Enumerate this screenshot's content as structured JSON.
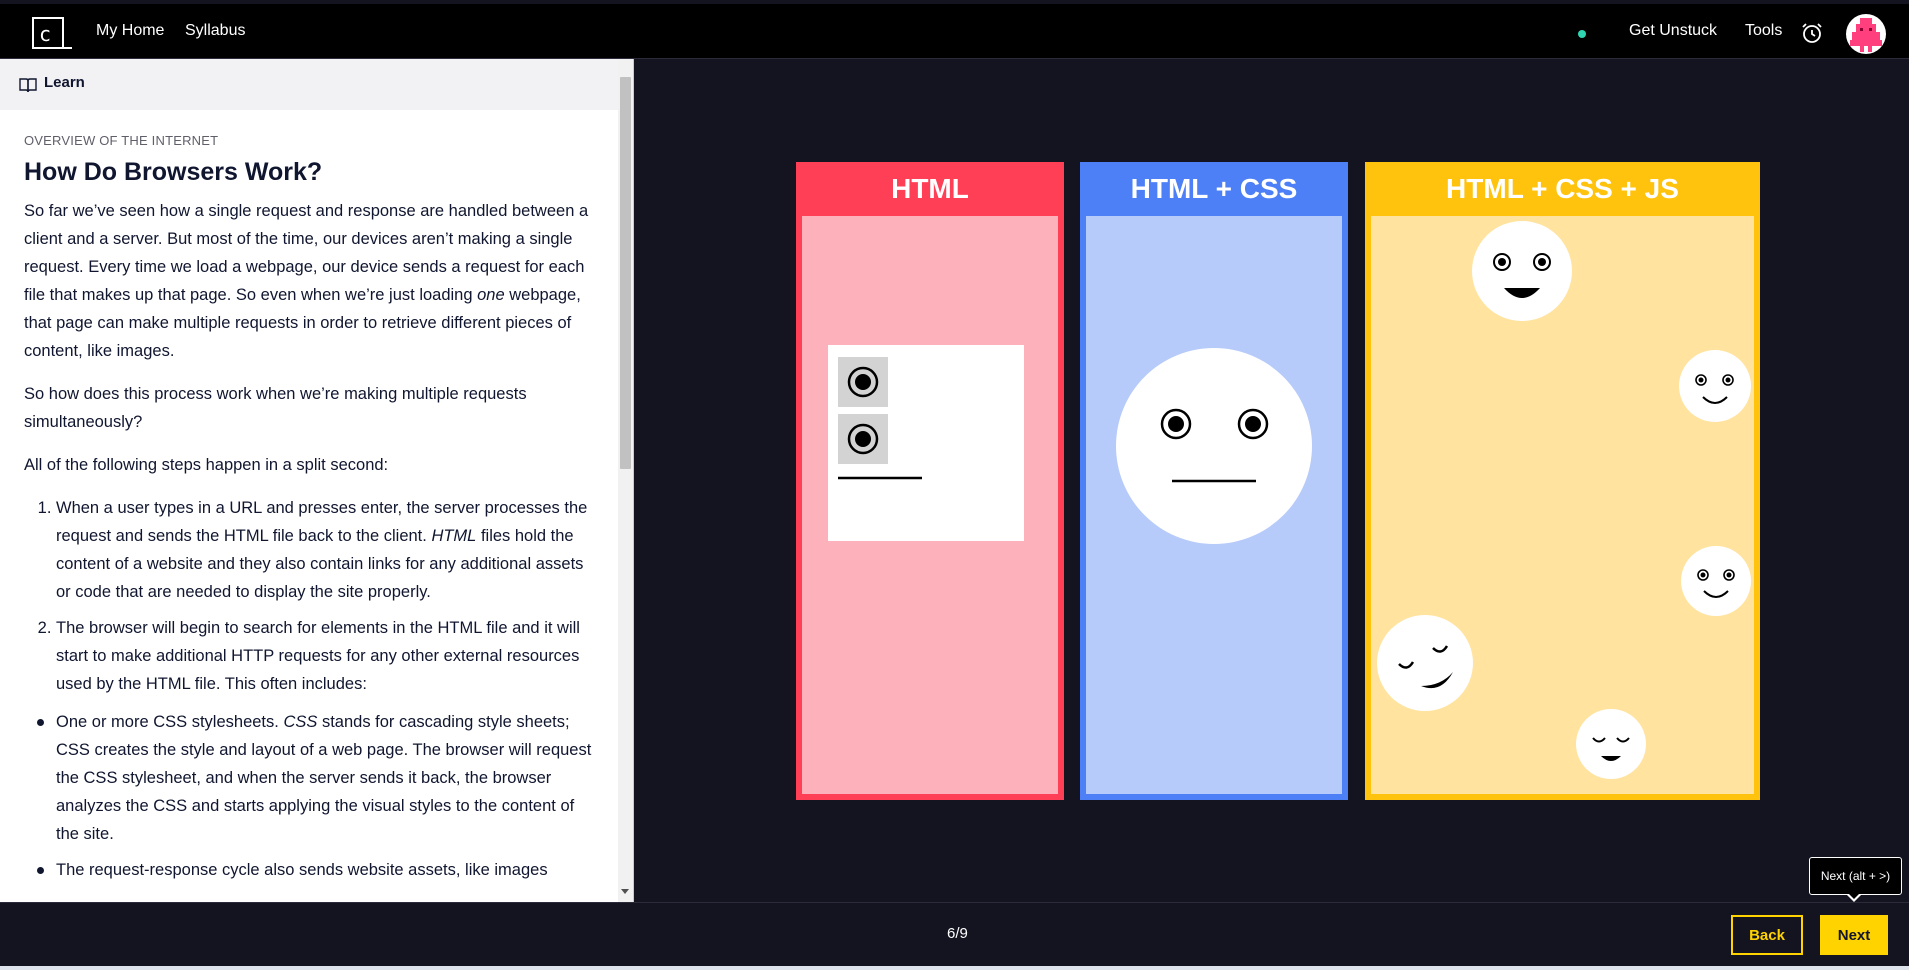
{
  "nav": {
    "logo_letter": "c",
    "my_home": "My Home",
    "syllabus": "Syllabus",
    "get_unstuck": "Get Unstuck",
    "tools": "Tools",
    "status_color": "#2fd6b1"
  },
  "learn_panel": {
    "tab_label": "Learn",
    "eyebrow": "OVERVIEW OF THE INTERNET",
    "title": "How Do Browsers Work?",
    "para1_a": "So far we’ve seen how a single request and response are handled between a client and a server. But most of the time, our devices aren’t making a single request. Every time we load a webpage, our device sends a request for each file that makes up that page. So even when we’re just loading ",
    "para1_em": "one",
    "para1_b": " webpage, that page can make multiple requests in order to retrieve different pieces of content, like images.",
    "para2": "So how does this process work when we’re making multiple requests simultaneously?",
    "para3": "All of the following steps happen in a split second:",
    "step1_a": "When a user types in a URL and presses enter, the server processes the request and sends the HTML file back to the client. ",
    "step1_em": "HTML",
    "step1_b": " files hold the content of a website and they also contain links for any additional assets or code that are needed to display the site properly.",
    "step2": "The browser will begin to search for elements in the HTML file and it will start to make additional HTTP requests for any other external resources used by the HTML file. This often includes:",
    "bullet1_a": "One or more CSS stylesheets. ",
    "bullet1_em": "CSS",
    "bullet1_b": " stands for cascading style sheets; CSS creates the style and layout of a web page. The browser will request the CSS stylesheet, and when the server sends it back, the browser analyzes the CSS and starts applying the visual styles to the content of the site.",
    "bullet2": "The request-response cycle also sends website assets, like images"
  },
  "illustration": {
    "columns": [
      {
        "label": "HTML",
        "frame_color": "#ff3f55",
        "body_color": "#fdb2bb"
      },
      {
        "label": "HTML + CSS",
        "frame_color": "#4d80f6",
        "body_color": "#b6cbfa"
      },
      {
        "label": "HTML + CSS + JS",
        "frame_color": "#ffc20d",
        "body_color": "#ffe39e"
      }
    ]
  },
  "footer": {
    "page_counter": "6/9",
    "back_label": "Back",
    "next_label": "Next",
    "next_tooltip": "Next (alt + >)",
    "accent_color": "#ffd300"
  }
}
